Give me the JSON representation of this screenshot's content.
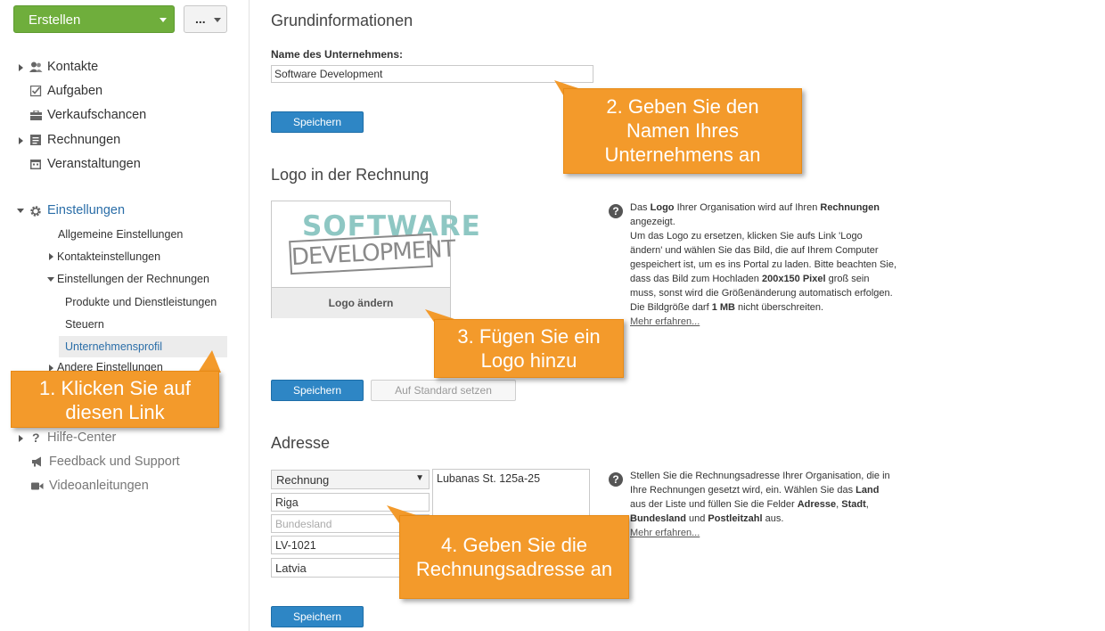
{
  "sidebar": {
    "create_label": "Erstellen",
    "more_label": "...",
    "items": [
      {
        "label": "Kontakte",
        "icon": "contacts-icon"
      },
      {
        "label": "Aufgaben",
        "icon": "tasks-icon"
      },
      {
        "label": "Verkaufschancen",
        "icon": "opportunities-icon"
      },
      {
        "label": "Rechnungen",
        "icon": "invoices-icon"
      },
      {
        "label": "Veranstaltungen",
        "icon": "events-icon"
      }
    ],
    "settings": {
      "label": "Einstellungen",
      "icon": "gear-icon",
      "general": "Allgemeine Einstellungen",
      "contact_settings": "Kontakteinstellungen",
      "invoice_settings": "Einstellungen der Rechnungen",
      "products": "Produkte und Dienstleistungen",
      "taxes": "Steuern",
      "company_profile": "Unternehmensprofil",
      "other_settings": "Andere Einstellungen"
    },
    "help_center": "Hilfe-Center",
    "feedback": "Feedback und Support",
    "videos": "Videoanleitungen"
  },
  "main": {
    "basic_info": {
      "title": "Grundinformationen",
      "company_name_label": "Name des Unternehmens:",
      "company_name_value": "Software Development",
      "save_label": "Speichern"
    },
    "logo": {
      "title": "Logo in der Rechnung",
      "logo_line1": "SOFTWARE",
      "logo_line2": "DEVELOPMENT",
      "change_label": "Logo ändern",
      "save_label": "Speichern",
      "reset_label": "Auf Standard setzen",
      "help": {
        "t1": "Das ",
        "b1": "Logo",
        "t2": " Ihrer Organisation wird auf Ihren ",
        "b2": "Rechnungen",
        "t3": " angezeigt.",
        "t4": "Um das Logo zu ersetzen, klicken Sie aufs Link 'Logo ändern' und wählen Sie das Bild, die auf Ihrem Computer gespeichert ist, um es ins Portal zu laden. Bitte beachten Sie, dass das Bild zum Hochladen ",
        "b3": "200x150 Pixel",
        "t5": " groß sein muss, sonst wird die Größenänderung automatisch erfolgen. Die Bildgröße darf ",
        "b4": "1 MB",
        "t6": " nicht überschreiten.",
        "more": "Mehr erfahren..."
      }
    },
    "address": {
      "title": "Adresse",
      "type_value": "Rechnung",
      "city": "Riga",
      "state_placeholder": "Bundesland",
      "zip": "LV-1021",
      "country": "Latvia",
      "street": "Lubanas St. 125a-25",
      "save_label": "Speichern",
      "help": {
        "t1": "Stellen Sie die Rechnungsadresse Ihrer Organisation, die in Ihre Rechnungen gesetzt wird, ein. Wählen Sie das ",
        "b1": "Land",
        "t2": " aus der Liste und füllen Sie die Felder ",
        "b2": "Adresse",
        "t3": ", ",
        "b3": "Stadt",
        "t4": ", ",
        "b4": "Bundesland",
        "t5": " und ",
        "b5": "Postleitzahl",
        "t6": " aus.",
        "more": "Mehr erfahren..."
      }
    }
  },
  "callouts": {
    "c1": [
      "1. Klicken Sie auf",
      "diesen Link"
    ],
    "c2": [
      "2. Geben Sie den",
      "Namen Ihres",
      "Unternehmens an"
    ],
    "c3": [
      "3. Fügen Sie ein",
      "Logo hinzu"
    ],
    "c4": [
      "4. Geben Sie die",
      "Rechnungsadresse an"
    ]
  },
  "colors": {
    "accent_green": "#6fae3c",
    "button_blue": "#2e86c5",
    "callout_orange": "#f39a2b",
    "link_active": "#2b6ea8"
  }
}
